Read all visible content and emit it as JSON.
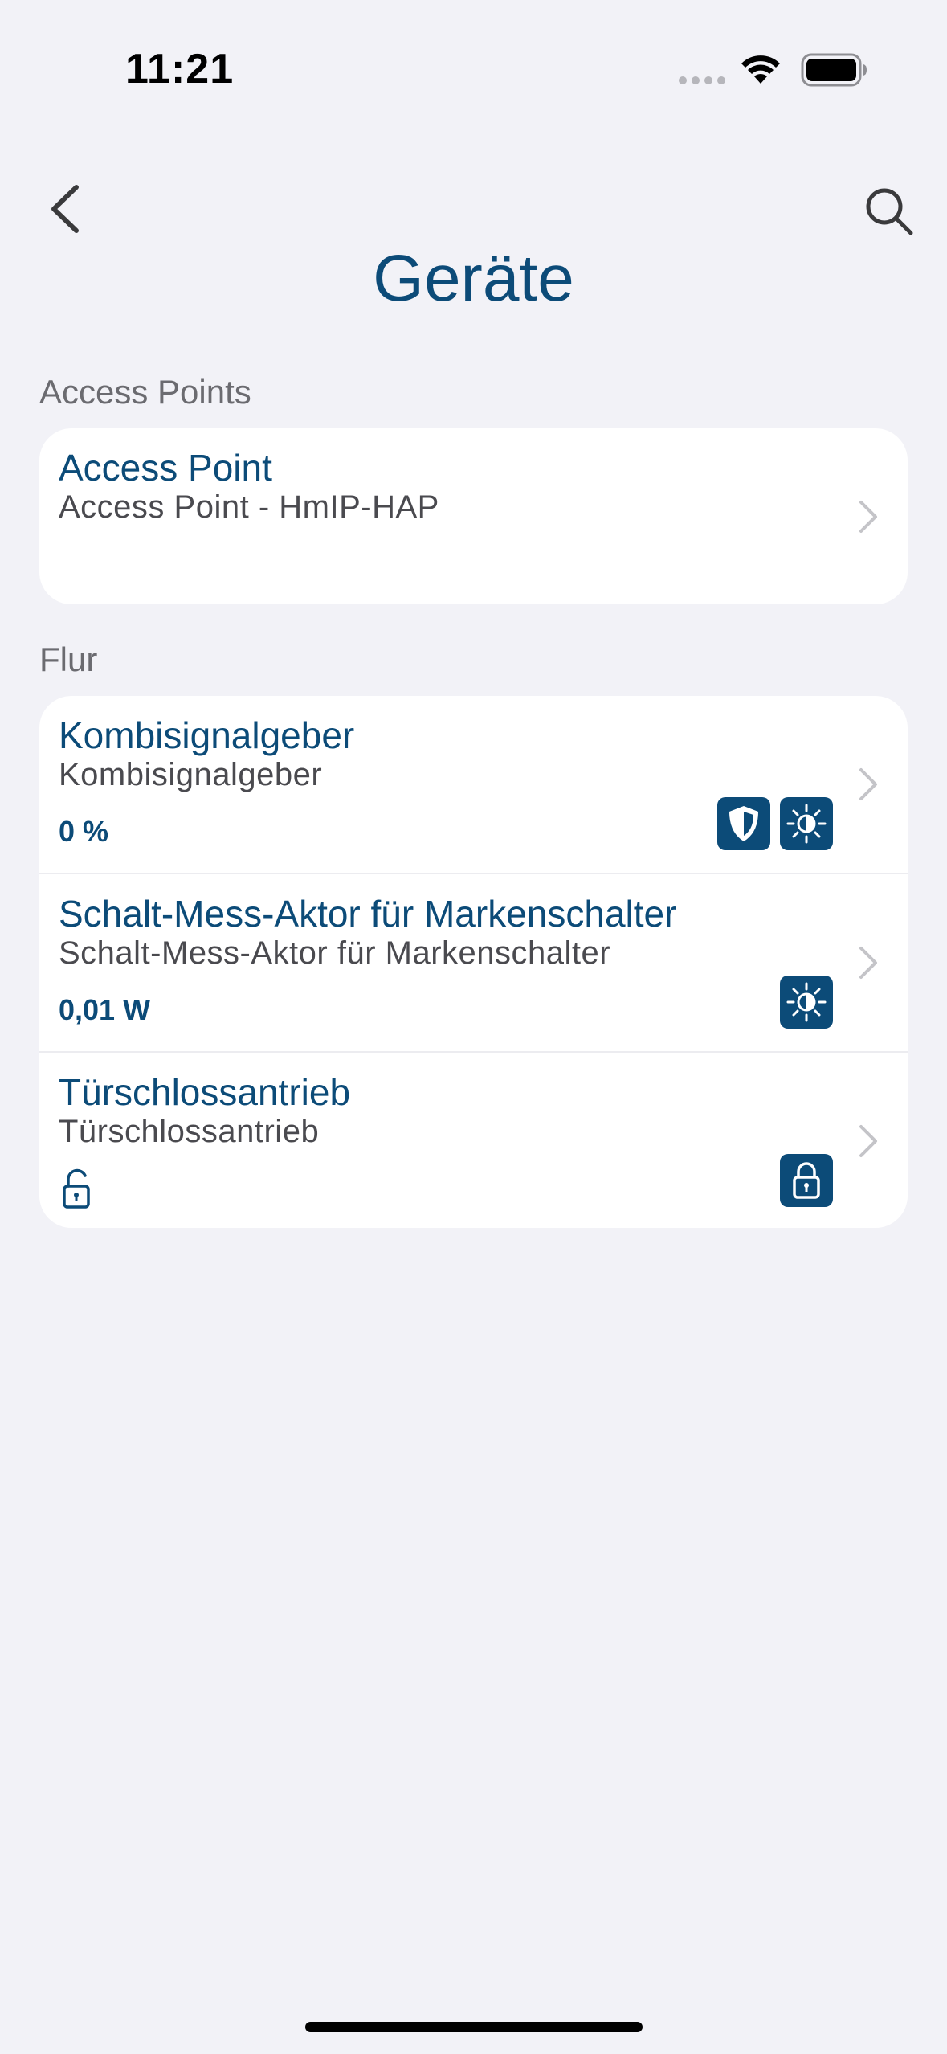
{
  "status_bar": {
    "time": "11:21"
  },
  "header": {
    "title": "Geräte"
  },
  "colors": {
    "accent": "#0c4b78",
    "background": "#f2f2f7",
    "card": "#ffffff"
  },
  "sections": [
    {
      "label": "Access Points",
      "items": [
        {
          "title": "Access Point",
          "subtitle": "Access Point - HmIP-HAP",
          "value": "",
          "status_icons": []
        }
      ]
    },
    {
      "label": "Flur",
      "items": [
        {
          "title": "Kombisignalgeber",
          "subtitle": "Kombisignalgeber",
          "value": "0 %",
          "status_icons": [
            "shield-icon",
            "brightness-icon"
          ]
        },
        {
          "title": "Schalt-Mess-Aktor für Markenschalter",
          "subtitle": "Schalt-Mess-Aktor für Markenschalter",
          "value": "0,01 W",
          "status_icons": [
            "brightness-icon"
          ]
        },
        {
          "title": "Türschlossantrieb",
          "subtitle": "Türschlossantrieb",
          "value": "",
          "value_icon": "unlocked-padlock-icon",
          "status_icons": [
            "padlock-icon"
          ]
        }
      ]
    }
  ]
}
